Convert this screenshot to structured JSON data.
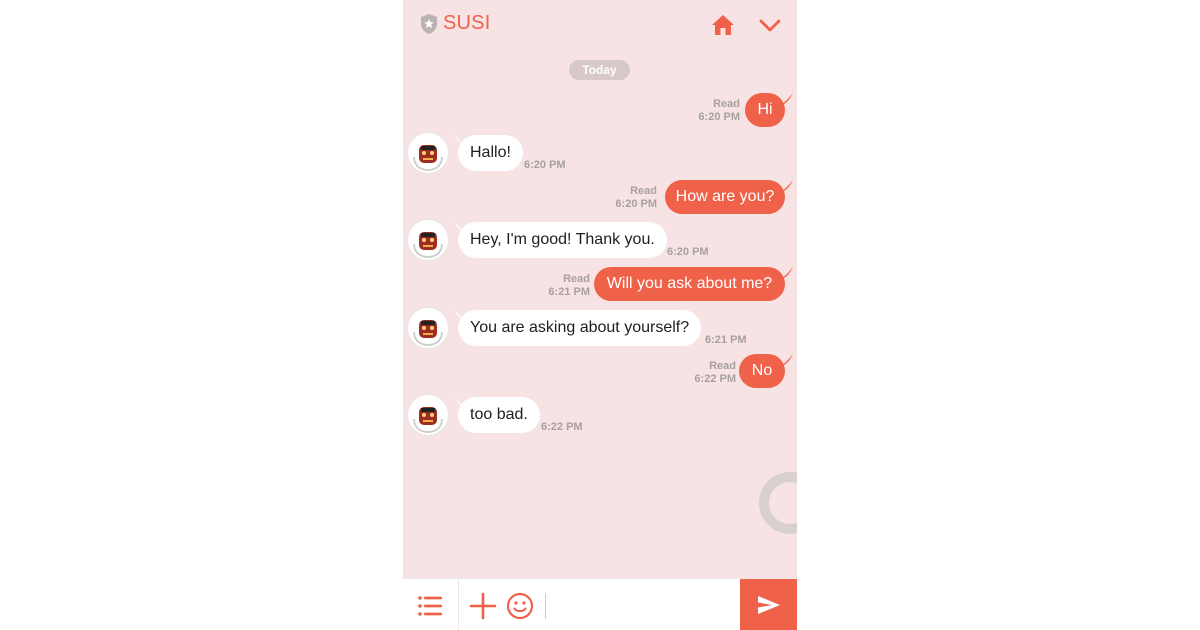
{
  "header": {
    "title": "SUSI",
    "icons": [
      "shield-icon",
      "home-icon",
      "chevron-down-icon"
    ]
  },
  "date_label": "Today",
  "colors": {
    "accent": "#ef6149",
    "background": "#f7e3e3",
    "bubble_in": "#ffffff"
  },
  "messages": [
    {
      "from": "user",
      "text": "Hi",
      "status": "Read",
      "time": "6:20 PM"
    },
    {
      "from": "bot",
      "text": "Hallo!",
      "time": "6:20 PM"
    },
    {
      "from": "user",
      "text": "How are you?",
      "status": "Read",
      "time": "6:20 PM"
    },
    {
      "from": "bot",
      "text": "Hey, I'm good! Thank you.",
      "time": "6:20 PM"
    },
    {
      "from": "user",
      "text": "Will you ask about me?",
      "status": "Read",
      "time": "6:21 PM"
    },
    {
      "from": "bot",
      "text": "You are asking about yourself?",
      "time": "6:21 PM"
    },
    {
      "from": "user",
      "text": "No",
      "status": "Read",
      "time": "6:22 PM"
    },
    {
      "from": "bot",
      "text": "too bad.",
      "time": "6:22 PM"
    }
  ],
  "composer": {
    "value": "",
    "placeholder": ""
  },
  "bottom_icons": [
    "menu-icon",
    "plus-icon",
    "smiley-icon",
    "send-icon"
  ]
}
